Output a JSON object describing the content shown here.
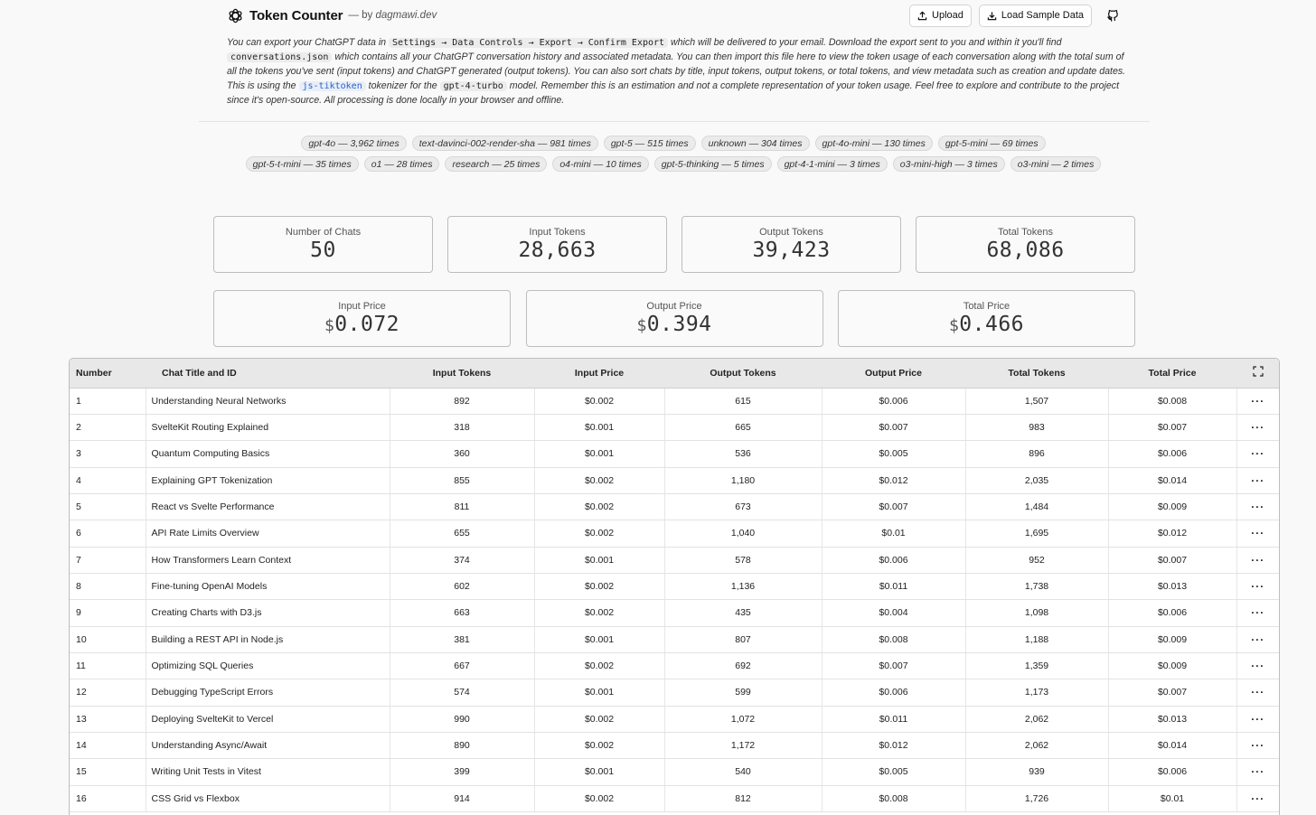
{
  "header": {
    "title": "Token Counter",
    "by_prefix": "— by",
    "author": "dagmawi.dev",
    "upload_label": "Upload",
    "sample_label": "Load Sample Data"
  },
  "intro": {
    "p1": "You can export your ChatGPT data in ",
    "c1": "Settings → Data Controls → Export → Confirm Export",
    "p2": " which will be delivered to your email. Download the export sent to you and within it you'll find ",
    "c2": "conversations.json",
    "p3": " which contains all your ChatGPT conversation history and associated metadata. You can then import this file here to view the token usage of each conversation along with the total sum of all the tokens you've sent (input tokens) and ChatGPT generated (output tokens). You can also sort chats by title, input tokens, output tokens, or total tokens, and view metadata such as creation and update dates. This is using the ",
    "c3": "js-tiktoken",
    "p4": " tokenizer for the ",
    "c4": "gpt-4-turbo",
    "p5": " model. Remember this is an estimation and not a complete representation of your token usage. Feel free to explore and contribute to the project since it's open-source. All processing is done locally in your browser and offline."
  },
  "models": [
    "gpt-4o — 3,962 times",
    "text-davinci-002-render-sha — 981 times",
    "gpt-5 — 515 times",
    "unknown — 304 times",
    "gpt-4o-mini — 130 times",
    "gpt-5-mini — 69 times",
    "gpt-5-t-mini — 35 times",
    "o1 — 28 times",
    "research — 25 times",
    "o4-mini — 10 times",
    "gpt-5-thinking — 5 times",
    "gpt-4-1-mini — 3 times",
    "o3-mini-high — 3 times",
    "o3-mini — 2 times"
  ],
  "stats": {
    "chats_label": "Number of Chats",
    "chats_value": "50",
    "input_label": "Input Tokens",
    "input_value": "28,663",
    "output_label": "Output Tokens",
    "output_value": "39,423",
    "total_label": "Total Tokens",
    "total_value": "68,086"
  },
  "prices": {
    "currency": "$",
    "input_label": "Input Price",
    "input_value": "0.072",
    "output_label": "Output Price",
    "output_value": "0.394",
    "total_label": "Total Price",
    "total_value": "0.466"
  },
  "table": {
    "headers": [
      "Number",
      "Chat Title and ID",
      "Input Tokens",
      "Input Price",
      "Output Tokens",
      "Output Price",
      "Total Tokens",
      "Total Price"
    ],
    "more_label": "···",
    "rows": [
      [
        "1",
        "Understanding Neural Networks",
        "892",
        "$0.002",
        "615",
        "$0.006",
        "1,507",
        "$0.008"
      ],
      [
        "2",
        "SvelteKit Routing Explained",
        "318",
        "$0.001",
        "665",
        "$0.007",
        "983",
        "$0.007"
      ],
      [
        "3",
        "Quantum Computing Basics",
        "360",
        "$0.001",
        "536",
        "$0.005",
        "896",
        "$0.006"
      ],
      [
        "4",
        "Explaining GPT Tokenization",
        "855",
        "$0.002",
        "1,180",
        "$0.012",
        "2,035",
        "$0.014"
      ],
      [
        "5",
        "React vs Svelte Performance",
        "811",
        "$0.002",
        "673",
        "$0.007",
        "1,484",
        "$0.009"
      ],
      [
        "6",
        "API Rate Limits Overview",
        "655",
        "$0.002",
        "1,040",
        "$0.01",
        "1,695",
        "$0.012"
      ],
      [
        "7",
        "How Transformers Learn Context",
        "374",
        "$0.001",
        "578",
        "$0.006",
        "952",
        "$0.007"
      ],
      [
        "8",
        "Fine-tuning OpenAI Models",
        "602",
        "$0.002",
        "1,136",
        "$0.011",
        "1,738",
        "$0.013"
      ],
      [
        "9",
        "Creating Charts with D3.js",
        "663",
        "$0.002",
        "435",
        "$0.004",
        "1,098",
        "$0.006"
      ],
      [
        "10",
        "Building a REST API in Node.js",
        "381",
        "$0.001",
        "807",
        "$0.008",
        "1,188",
        "$0.009"
      ],
      [
        "11",
        "Optimizing SQL Queries",
        "667",
        "$0.002",
        "692",
        "$0.007",
        "1,359",
        "$0.009"
      ],
      [
        "12",
        "Debugging TypeScript Errors",
        "574",
        "$0.001",
        "599",
        "$0.006",
        "1,173",
        "$0.007"
      ],
      [
        "13",
        "Deploying SvelteKit to Vercel",
        "990",
        "$0.002",
        "1,072",
        "$0.011",
        "2,062",
        "$0.013"
      ],
      [
        "14",
        "Understanding Async/Await",
        "890",
        "$0.002",
        "1,172",
        "$0.012",
        "2,062",
        "$0.014"
      ],
      [
        "15",
        "Writing Unit Tests in Vitest",
        "399",
        "$0.001",
        "540",
        "$0.005",
        "939",
        "$0.006"
      ],
      [
        "16",
        "CSS Grid vs Flexbox",
        "914",
        "$0.002",
        "812",
        "$0.008",
        "1,726",
        "$0.01"
      ]
    ]
  },
  "icons": {
    "logo": "openai-logo-icon",
    "upload": "upload-icon",
    "download": "download-icon",
    "github": "github-icon",
    "expand": "expand-icon",
    "more": "more-dots-icon"
  }
}
